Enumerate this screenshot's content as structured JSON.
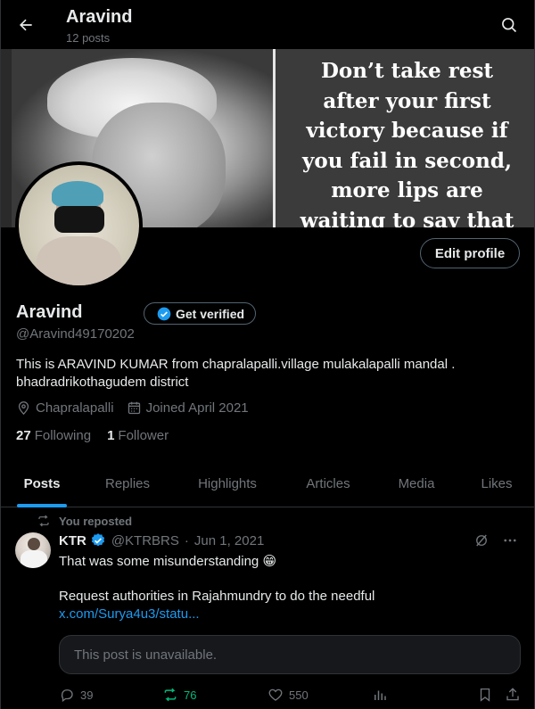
{
  "header": {
    "name": "Aravind",
    "post_count": "12 posts",
    "back_icon": "arrow-left-icon",
    "search_icon": "search-icon"
  },
  "banner": {
    "quote_lines": [
      "Don’t take rest",
      "after your first",
      "victory because if",
      "you fail in second,",
      "more lips are",
      "waiting to say that"
    ]
  },
  "profile": {
    "edit_button": "Edit profile",
    "name": "Aravind",
    "verify_button": "Get verified",
    "handle": "@Aravind49170202",
    "bio_line1": "This is ARAVIND KUMAR from chapralapalli.village mulakalapalli mandal .",
    "bio_line2": "bhadradrikothagudem district",
    "location": "Chapralapalli",
    "joined": "Joined April 2021",
    "following_count": "27",
    "following_label": "Following",
    "followers_count": "1",
    "followers_label": "Follower"
  },
  "tabs": [
    {
      "label": "Posts",
      "active": true
    },
    {
      "label": "Replies",
      "active": false
    },
    {
      "label": "Highlights",
      "active": false
    },
    {
      "label": "Articles",
      "active": false
    },
    {
      "label": "Media",
      "active": false
    },
    {
      "label": "Likes",
      "active": false
    }
  ],
  "post": {
    "repost_label": "You reposted",
    "author": "KTR",
    "handle": "@KTRBRS",
    "separator": "·",
    "date": "Jun 1, 2021",
    "text_line1": "That was some misunderstanding 😁",
    "text_line2": "Request authorities in Rajahmundry to do the needful",
    "link": "x.com/Surya4u3/statu...",
    "quoted_unavailable": "This post is unavailable.",
    "replies": "39",
    "reposts": "76",
    "likes": "550"
  },
  "colors": {
    "accent": "#1d9bf0",
    "repost_green": "#00ba7c",
    "muted": "#71767b",
    "text": "#e7e9ea",
    "background": "#000000"
  }
}
